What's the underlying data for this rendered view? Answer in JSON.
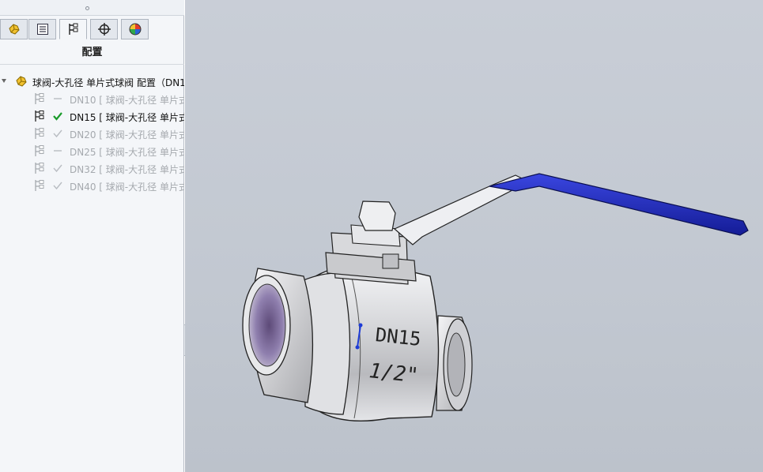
{
  "panel": {
    "title": "配置",
    "tabs": [
      {
        "name": "feature-manager-tab",
        "icon": "part-icon",
        "active": false
      },
      {
        "name": "property-manager-tab",
        "icon": "property-list-icon",
        "active": false
      },
      {
        "name": "configuration-manager-tab",
        "icon": "configuration-icon",
        "active": true
      },
      {
        "name": "dimxpert-manager-tab",
        "icon": "crosshair-icon",
        "active": false
      },
      {
        "name": "display-manager-tab",
        "icon": "appearance-pie-icon",
        "active": false
      }
    ]
  },
  "tree": {
    "root_label": "球阀-大孔径 单片式球阀 配置（DN1",
    "items": [
      {
        "label": "DN10 [ 球阀-大孔径 单片式",
        "state": "dash",
        "active": false
      },
      {
        "label": "DN15 [ 球阀-大孔径 单片式",
        "state": "check",
        "active": true
      },
      {
        "label": "DN20 [ 球阀-大孔径 单片式",
        "state": "check",
        "active": false
      },
      {
        "label": "DN25 [ 球阀-大孔径 单片式",
        "state": "dash",
        "active": false
      },
      {
        "label": "DN32 [ 球阀-大孔径 单片式",
        "state": "check",
        "active": false
      },
      {
        "label": "DN40 [ 球阀-大孔径 单片式",
        "state": "check",
        "active": false
      }
    ]
  },
  "model": {
    "body_text_1": "DN15",
    "body_text_2": "1/2\"",
    "handle_color": "#1f2cc4",
    "body_color": "#d6d7da"
  }
}
